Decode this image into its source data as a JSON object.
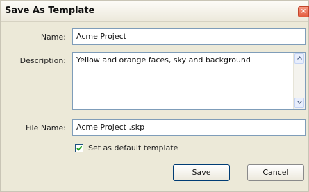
{
  "window": {
    "title": "Save As Template",
    "close_label": "×"
  },
  "form": {
    "name_label": "Name:",
    "name_value": "Acme Project",
    "description_label": "Description:",
    "description_value": "Yellow and orange faces, sky and background",
    "file_name_label": "File Name:",
    "file_name_value": "Acme Project .skp",
    "default_template_label": "Set as default template",
    "default_template_checked": true
  },
  "buttons": {
    "save_label": "Save",
    "cancel_label": "Cancel"
  },
  "colors": {
    "dialog_bg": "#ece9d8",
    "field_border": "#7f9db9",
    "close_button": "#e35a3d"
  }
}
